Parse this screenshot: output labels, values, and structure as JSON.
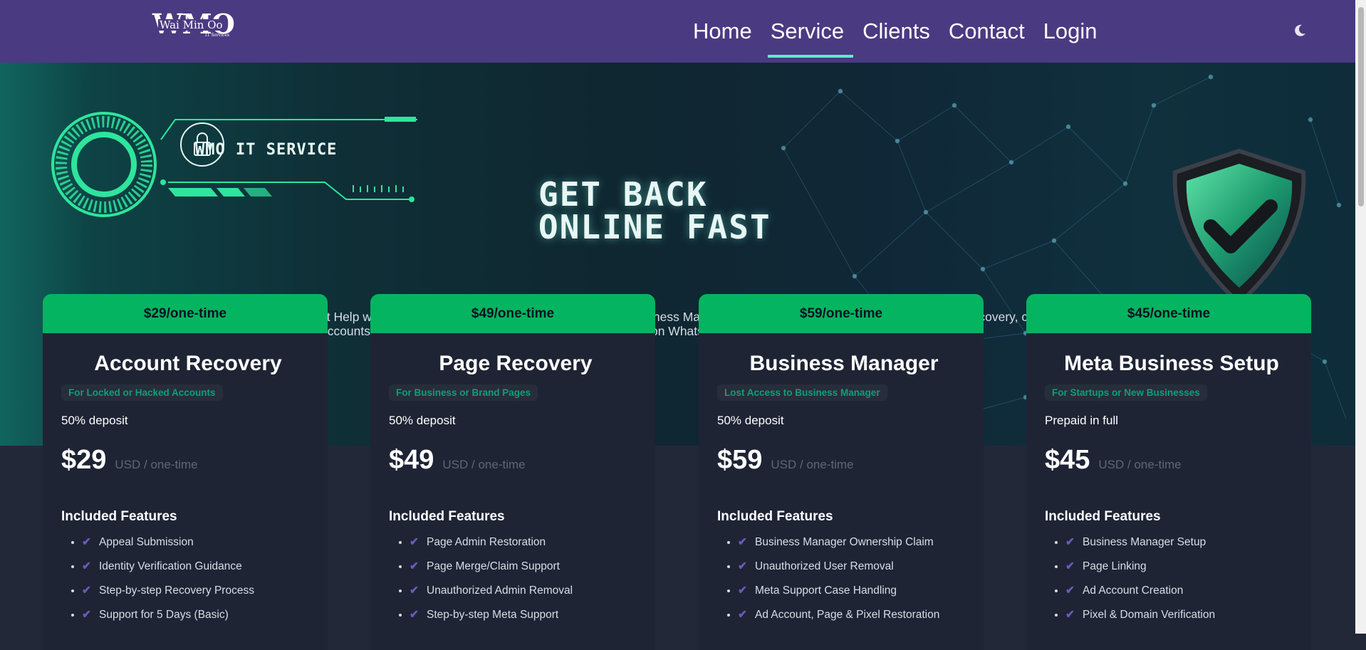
{
  "brand": {
    "logo_big": "WMO",
    "logo_name": "Wai Min Oo",
    "logo_tagline": "IT Services"
  },
  "nav": {
    "links": [
      "Home",
      "Service",
      "Clients",
      "Contact",
      "Login"
    ],
    "active": "Service",
    "theme_icon": "moon-icon"
  },
  "hero": {
    "badge_title": "WMO IT SERVICE",
    "headline_line1": "GET BACK",
    "headline_line2": "ONLINE FAST",
    "description": "Expert Help with Facebook & Instagram Account, Page, and Business Manager Recovery. We also assist with ad account recovery, creating new accounts, and more. Not sure what you need? Chat with us on WhatsApp for personalized support."
  },
  "cards": [
    {
      "header": "$29/one-time",
      "title": "Account Recovery",
      "tag": "For Locked or Hacked Accounts",
      "deposit": "50% deposit",
      "price": "$29",
      "unit": "USD / one-time",
      "features_title": "Included Features",
      "features": [
        "Appeal Submission",
        "Identity Verification Guidance",
        "Step-by-step Recovery Process",
        "Support for 5 Days (Basic)"
      ]
    },
    {
      "header": "$49/one-time",
      "title": "Page Recovery",
      "tag": "For Business or Brand Pages",
      "deposit": "50% deposit",
      "price": "$49",
      "unit": "USD / one-time",
      "features_title": "Included Features",
      "features": [
        "Page Admin Restoration",
        "Page Merge/Claim Support",
        "Unauthorized Admin Removal",
        "Step-by-step Meta Support"
      ]
    },
    {
      "header": "$59/one-time",
      "title": "Business Manager",
      "tag": "Lost Access to Business Manager",
      "deposit": "50% deposit",
      "price": "$59",
      "unit": "USD / one-time",
      "features_title": "Included Features",
      "features": [
        "Business Manager Ownership Claim",
        "Unauthorized User Removal",
        "Meta Support Case Handling",
        "Ad Account, Page & Pixel Restoration"
      ]
    },
    {
      "header": "$45/one-time",
      "title": "Meta Business Setup",
      "tag": "For Startups or New Businesses",
      "deposit": "Prepaid in full",
      "price": "$45",
      "unit": "USD / one-time",
      "features_title": "Included Features",
      "features": [
        "Business Manager Setup",
        "Page Linking",
        "Ad Account Creation",
        "Pixel & Domain Verification"
      ]
    }
  ],
  "colors": {
    "nav_bg": "#4a3a82",
    "accent_underline": "#5eead4",
    "card_header": "#05b461",
    "card_bg": "#1e2434",
    "tag_text": "#0f9e77",
    "check": "#6d59b8"
  }
}
